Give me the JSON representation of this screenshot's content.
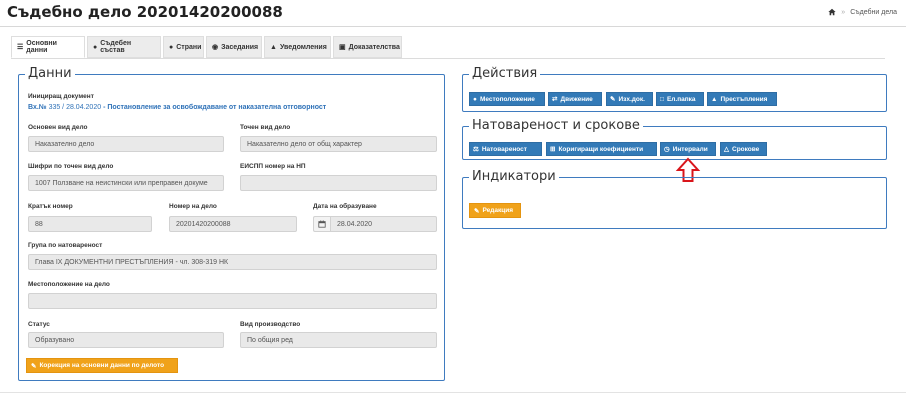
{
  "header": {
    "title": "Съдебно дело 20201420200088",
    "breadcrumb": "Съдебни дела",
    "breadcrumb_sep": "»"
  },
  "tabs": [
    {
      "icon": "list-icon",
      "glyph": "☰",
      "label": "Основни данни",
      "active": true
    },
    {
      "icon": "users-icon",
      "glyph": "●",
      "label": "Съдебен състав"
    },
    {
      "icon": "user-icon",
      "glyph": "●",
      "label": "Страни"
    },
    {
      "icon": "eye-icon",
      "glyph": "◉",
      "label": "Заседания"
    },
    {
      "icon": "bell-icon",
      "glyph": "▲",
      "label": "Уведомления"
    },
    {
      "icon": "archive-icon",
      "glyph": "▣",
      "label": "Доказателства"
    }
  ],
  "main": {
    "legend": "Данни",
    "initiating_doc_label": "Инициращ документ",
    "initiating_doc_no": "Вх.№",
    "initiating_doc_nums": "335 / 28.04.2020",
    "initiating_doc_sep": "-",
    "initiating_doc_type": "Постановление за освобождаване от наказателна отговорност",
    "fields": {
      "case_kind_label": "Основен вид дело",
      "case_kind_value": "Наказателно дело",
      "exact_kind_label": "Точен вид дело",
      "exact_kind_value": "Наказателно дело от общ характер",
      "cipher_label": "Шифри по точен вид дело",
      "cipher_value": "1007 Ползване на неистински или преправен докуме",
      "eispp_label": "ЕИСПП номер на НП",
      "eispp_value": "",
      "short_no_label": "Кратък номер",
      "short_no_value": "88",
      "case_no_label": "Номер на дело",
      "case_no_value": "20201420200088",
      "created_label": "Дата на образуване",
      "created_value": "28.04.2020",
      "load_group_label": "Група по натовареност",
      "load_group_value": "Глава IX ДОКУМЕНТНИ ПРЕСТЪПЛЕНИЯ  - чл. 308-319 НК",
      "location_label": "Местоположение на дело",
      "location_value": "",
      "status_label": "Статус",
      "status_value": "Образувано",
      "proceeding_label": "Вид производство",
      "proceeding_value": "По общия ред"
    },
    "correct_button": "Корекция на основни данни по делото"
  },
  "actions": {
    "legend": "Действия",
    "buttons": [
      "Местоположение",
      "Движение",
      "Изх.док.",
      "Ел.папка",
      "Престъпления"
    ]
  },
  "workload": {
    "legend": "Натовареност и срокове",
    "buttons": [
      "Натовареност",
      "Коригиращи коефициенти",
      "Интервали",
      "Срокове"
    ]
  },
  "indicators": {
    "legend": "Индикатори",
    "edit_button": "Редакция"
  },
  "colors": {
    "primary": "#337ab7",
    "warning": "#f0a21a",
    "fieldset_border": "#3f7bbf",
    "arrow": "#d9151b"
  }
}
